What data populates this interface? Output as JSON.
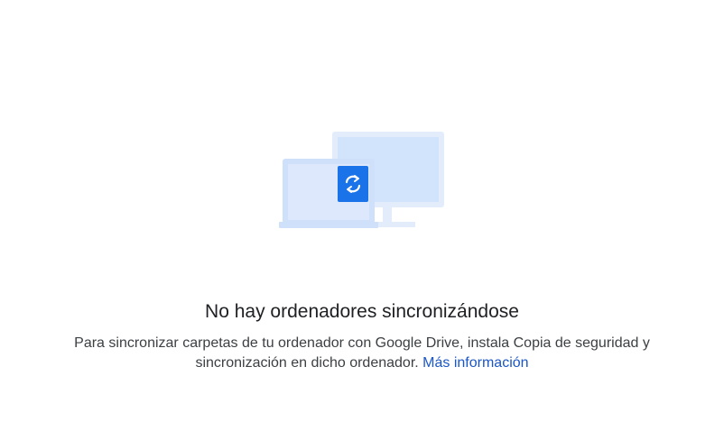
{
  "empty_state": {
    "illustration_icon": "computers-sync-icon",
    "title": "No hay ordenadores sincronizándose",
    "description": "Para sincronizar carpetas de tu ordenador con Google Drive, instala Copia de seguridad y sincronización en dicho ordenador.",
    "link_label": "Más información"
  },
  "colors": {
    "illustration_light": "#e1ebfb",
    "illustration_mid": "#d2e3fc",
    "sync_badge": "#1a73e8",
    "link": "#1a56c6",
    "title_text": "#202124",
    "body_text": "#3c4043"
  }
}
